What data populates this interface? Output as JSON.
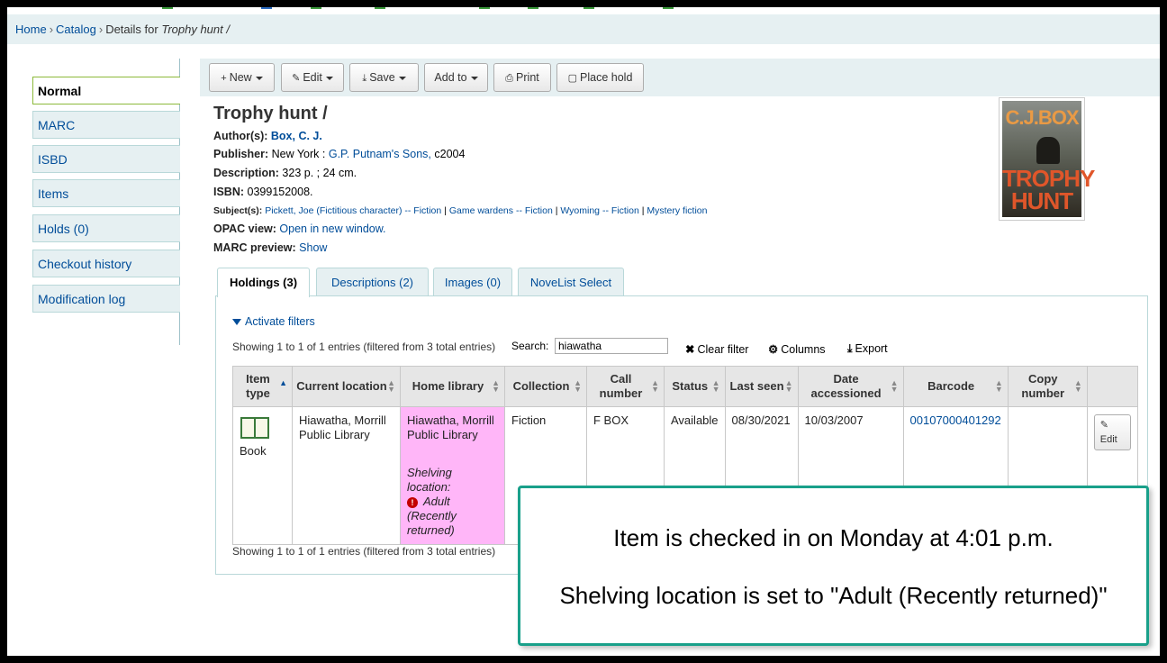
{
  "breadcrumb": {
    "home": "Home",
    "catalog": "Catalog",
    "details_prefix": "Details for",
    "record_title": "Trophy hunt /"
  },
  "nav": {
    "items": [
      {
        "label": "Normal",
        "active": true
      },
      {
        "label": "MARC"
      },
      {
        "label": "ISBD"
      },
      {
        "label": "Items"
      },
      {
        "label": "Holds (0)"
      },
      {
        "label": "Checkout history"
      },
      {
        "label": "Modification log"
      }
    ]
  },
  "toolbar": {
    "new": "New",
    "edit": "Edit",
    "save": "Save",
    "add_to": "Add to",
    "print": "Print",
    "place_hold": "Place hold"
  },
  "record": {
    "title": "Trophy hunt /",
    "author_label": "Author(s):",
    "author": "Box, C. J.",
    "publisher_label": "Publisher:",
    "publisher_place": "New York :",
    "publisher_name": "G.P. Putnam's Sons,",
    "publisher_year": "c2004",
    "description_label": "Description:",
    "description": "323 p. ; 24 cm.",
    "isbn_label": "ISBN:",
    "isbn": "0399152008.",
    "subjects_label": "Subject(s):",
    "subjects": [
      "Pickett, Joe (Fictitious character) -- Fiction",
      "Game wardens -- Fiction",
      "Wyoming -- Fiction",
      "Mystery fiction"
    ],
    "subject_sep": "|",
    "opac_label": "OPAC view:",
    "opac_link": "Open in new window.",
    "marc_label": "MARC preview:",
    "marc_link": "Show"
  },
  "cover": {
    "author": "C.J.BOX",
    "title_line1": "TROPHY",
    "title_line2": "HUNT"
  },
  "tabs": [
    {
      "label": "Holdings (3)",
      "active": true
    },
    {
      "label": "Descriptions (2)"
    },
    {
      "label": "Images (0)"
    },
    {
      "label": "NoveList Select"
    }
  ],
  "holdings": {
    "activate_filters": "Activate filters",
    "showing": "Showing 1 to 1 of 1 entries (filtered from 3 total entries)",
    "search_label": "Search:",
    "search_value": "hiawatha",
    "clear_filter": "Clear filter",
    "columns": "Columns",
    "export": "Export",
    "headers": [
      "Item type",
      "Current location",
      "Home library",
      "Collection",
      "Call number",
      "Status",
      "Last seen",
      "Date accessioned",
      "Barcode",
      "Copy number",
      ""
    ],
    "row": {
      "item_type": "Book",
      "current_location": "Hiawatha, Morrill Public Library",
      "home_library": "Hiawatha, Morrill Public Library",
      "shelving_label": "Shelving location:",
      "shelving_value": "Adult (Recently returned)",
      "collection": "Fiction",
      "call_number": "F BOX",
      "status": "Available",
      "last_seen": "08/30/2021",
      "date_accessioned": "10/03/2007",
      "barcode": "00107000401292",
      "copy_number": "",
      "edit": "Edit"
    },
    "highlight_color": "#ffb6f8"
  },
  "callout": {
    "line1": "Item is checked in on Monday at 4:01 p.m.",
    "line2": "Shelving location is set to \"Adult (Recently returned)\"",
    "border_color": "#19a08a"
  }
}
